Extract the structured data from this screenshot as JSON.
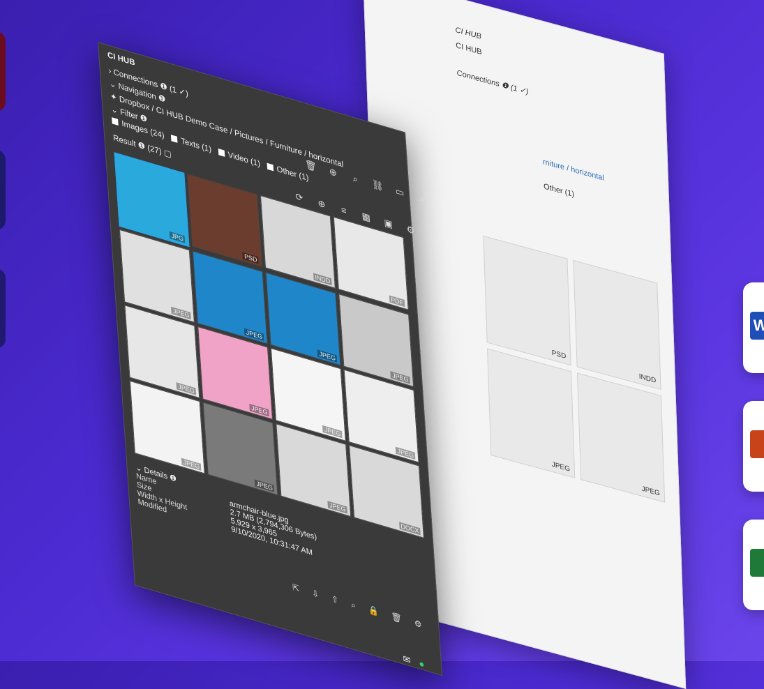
{
  "app": {
    "title": "CI HUB"
  },
  "light": {
    "title": "CI HUB",
    "sub": "CI HUB",
    "connections": "Connections ❶ (1 ✓)",
    "path": "rniture / horizontal",
    "other": "Other (1)",
    "cards": [
      {
        "type": "PSD"
      },
      {
        "type": "INDD"
      },
      {
        "type": "JPEG"
      },
      {
        "type": "JPEG"
      }
    ]
  },
  "dark": {
    "header": "CI HUB",
    "connections": "Connections ❶ (1 ✓)",
    "navigation": "Navigation ❶",
    "breadcrumb": "Dropbox / CI HUB Demo Case / Pictures / Furniture / horizontal",
    "filter": "Filter ❶",
    "filters": [
      {
        "label": "Images (24)"
      },
      {
        "label": "Texts (1)"
      },
      {
        "label": "Video (1)"
      },
      {
        "label": "Other (1)"
      }
    ],
    "result": "Result ❶ (27)",
    "thumbs": [
      {
        "type": "JPG",
        "color": "#2aa9dd",
        "selected": true
      },
      {
        "type": "PSD",
        "color": "#6b3d2f"
      },
      {
        "type": "INDD",
        "color": "#d8d8d8"
      },
      {
        "type": "PDF",
        "color": "#e8e8e8"
      },
      {
        "type": "JPEG",
        "color": "#e0e0e0"
      },
      {
        "type": "JPEG",
        "color": "#1f86c9"
      },
      {
        "type": "JPEG",
        "color": "#1f86c9"
      },
      {
        "type": "JPEG",
        "color": "#c9c9c9"
      },
      {
        "type": "JPEG",
        "color": "#e7e7e7"
      },
      {
        "type": "JPEG",
        "color": "#f0a3c6"
      },
      {
        "type": "JPEG",
        "color": "#f5f5f5"
      },
      {
        "type": "JPEG",
        "color": "#eeeeee"
      },
      {
        "type": "JPEG",
        "color": "#f3f3f3"
      },
      {
        "type": "JPEG",
        "color": "#7a7a7a"
      },
      {
        "type": "JPEG",
        "color": "#d9d9d9"
      },
      {
        "type": "DOCX",
        "color": "#d9d9d9"
      }
    ],
    "details": {
      "heading": "Details ❶",
      "rows": [
        {
          "k": "Name",
          "v": "armchair-blue.jpg"
        },
        {
          "k": "Size",
          "v": "2.7 MB (2,794,306 Bytes)"
        },
        {
          "k": "Width x Height",
          "v": "5,929 x 3,965"
        },
        {
          "k": "Modified",
          "v": "9/10/2020, 10:31:47 AM"
        }
      ]
    }
  },
  "colors": {
    "bg1": "#3a1fb0",
    "bg2": "#6a45ea",
    "selected": "#27a7e8"
  }
}
